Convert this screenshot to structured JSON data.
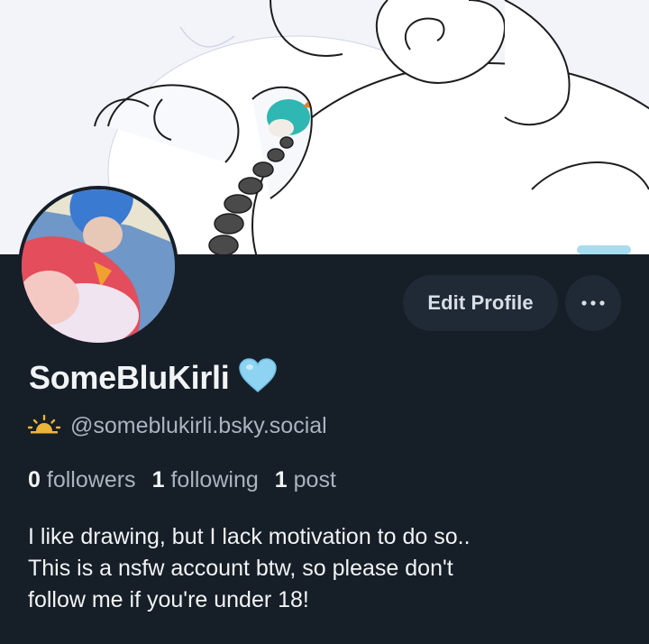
{
  "banner": {
    "description_icon": "banner-artwork"
  },
  "avatar": {
    "icon": "avatar-artwork"
  },
  "actions": {
    "edit_profile_label": "Edit Profile",
    "more_icon": "more-dots-icon"
  },
  "profile": {
    "display_name": "SomeBluKirli",
    "name_emoji_icon": "light-blue-heart-icon",
    "handle_icon": "sunrise-icon",
    "handle": "@someblukirli.bsky.social",
    "stats": {
      "followers_count": "0",
      "followers_label": "followers",
      "following_count": "1",
      "following_label": "following",
      "posts_count": "1",
      "posts_label": "post"
    },
    "bio_lines": [
      "I like drawing, but I lack motivation to do so..",
      "This is a nsfw account btw, so please don't",
      "follow me if you're under 18!"
    ]
  },
  "colors": {
    "background": "#161e27",
    "button_bg": "#1f2a36",
    "text_primary": "#f1f3f5",
    "text_secondary": "#aab4c0",
    "heart": "#8fd3f2",
    "sun": "#e8b53a"
  }
}
